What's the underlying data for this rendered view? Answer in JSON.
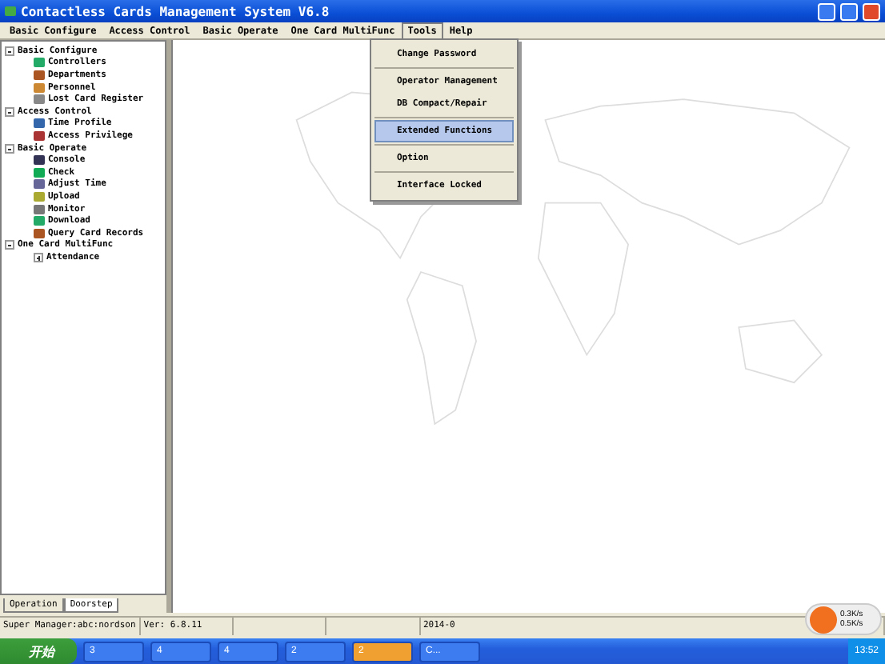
{
  "window": {
    "title": "Contactless Cards Management System  V6.8"
  },
  "menu": [
    {
      "label": "Basic Configure",
      "selected": false
    },
    {
      "label": "Access Control",
      "selected": false
    },
    {
      "label": "Basic Operate",
      "selected": false
    },
    {
      "label": "One Card MultiFunc",
      "selected": false
    },
    {
      "label": "Tools",
      "selected": true
    },
    {
      "label": "Help",
      "selected": false
    }
  ],
  "dropdown": [
    {
      "label": "Change Password",
      "selected": false
    },
    {
      "label": "Operator Management",
      "selected": false
    },
    {
      "label": "DB Compact/Repair",
      "selected": false
    },
    {
      "label": "Extended Functions",
      "selected": true
    },
    {
      "label": "Option",
      "selected": false
    },
    {
      "label": "Interface Locked",
      "selected": false
    }
  ],
  "tree": [
    {
      "label": "Basic Configure",
      "expanded": true,
      "children": [
        {
          "label": "Controllers"
        },
        {
          "label": "Departments"
        },
        {
          "label": "Personnel"
        },
        {
          "label": "Lost Card Register"
        }
      ]
    },
    {
      "label": "Access Control",
      "expanded": true,
      "children": [
        {
          "label": "Time Profile"
        },
        {
          "label": "Access Privilege"
        }
      ]
    },
    {
      "label": "Basic Operate",
      "expanded": true,
      "children": [
        {
          "label": "Console"
        },
        {
          "label": "Check"
        },
        {
          "label": "Adjust Time"
        },
        {
          "label": "Upload"
        },
        {
          "label": "Monitor"
        },
        {
          "label": "Download"
        },
        {
          "label": "Query Card Records"
        }
      ]
    },
    {
      "label": "One Card MultiFunc",
      "expanded": true,
      "children": [
        {
          "label": "Attendance",
          "expanded": false
        }
      ]
    }
  ],
  "tabs": [
    {
      "label": "Operation",
      "selected": false
    },
    {
      "label": "Doorstep",
      "selected": true
    }
  ],
  "status_bar": {
    "user": "Super Manager:abc:nordson",
    "version": "Ver: 6.8.11",
    "date": "2014-0"
  },
  "network": {
    "up": "0.3K/s",
    "down": "0.5K/s"
  },
  "taskbar": {
    "start": "开始",
    "items": [
      {
        "label": "3",
        "active": false
      },
      {
        "label": "4",
        "active": false
      },
      {
        "label": "4",
        "active": false
      },
      {
        "label": "2",
        "active": false
      },
      {
        "label": "2",
        "active": true
      },
      {
        "label": "C...",
        "active": false
      }
    ],
    "clock": "13:52"
  }
}
